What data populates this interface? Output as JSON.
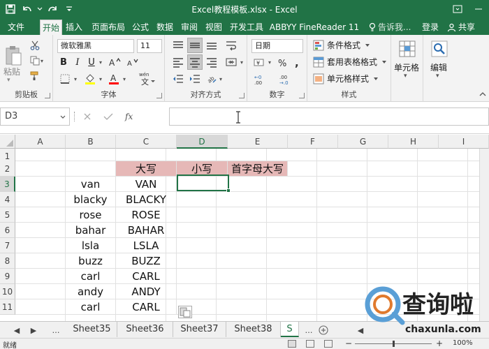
{
  "titlebar": {
    "title": "Excel教程模板.xlsx - Excel",
    "bg": "#217346"
  },
  "ribbon_tabs": [
    "文件",
    "开始",
    "插入",
    "页面布局",
    "公式",
    "数据",
    "审阅",
    "视图",
    "开发工具",
    "ABBYY FineReader 11"
  ],
  "active_tab": "开始",
  "tell_me": "告诉我...",
  "signin": "登录",
  "share": "共享",
  "clipboard": {
    "paste": "粘贴",
    "label": "剪贴板"
  },
  "font": {
    "name": "微软雅黑",
    "size": "11",
    "label": "字体"
  },
  "alignment": {
    "label": "对齐方式"
  },
  "number": {
    "format": "日期",
    "label": "数字"
  },
  "styles": {
    "conditional": "条件格式",
    "table": "套用表格格式",
    "cell_styles": "单元格样式",
    "label": "样式"
  },
  "cells": {
    "label": "单元格"
  },
  "editing": {
    "label": "编辑"
  },
  "formula_bar": {
    "name_box": "D3",
    "formula": ""
  },
  "columns": [
    "A",
    "B",
    "C",
    "D",
    "E",
    "F",
    "G",
    "H",
    "I"
  ],
  "rows": [
    "1",
    "2",
    "3",
    "4",
    "5",
    "6",
    "7",
    "8",
    "9",
    "10",
    "11"
  ],
  "table": {
    "header": [
      "大写",
      "小写",
      "首字母大写"
    ],
    "header_color": "#e6b8b7",
    "rows": [
      [
        "van",
        "VAN"
      ],
      [
        "blacky",
        "BLACKY"
      ],
      [
        "rose",
        "ROSE"
      ],
      [
        "bahar",
        "BAHAR"
      ],
      [
        "lsla",
        "LSLA"
      ],
      [
        "buzz",
        "BUZZ"
      ],
      [
        "carl",
        "CARL"
      ],
      [
        "andy",
        "ANDY"
      ],
      [
        "carl",
        "CARL"
      ]
    ]
  },
  "sheet_tabs": [
    "Sheet35",
    "Sheet36",
    "Sheet37",
    "Sheet38",
    "S"
  ],
  "active_sheet": "S",
  "status": {
    "mode": "就绪",
    "zoom": "100%"
  },
  "watermark": {
    "logo_text": "查询啦",
    "url": "chaxunla.com"
  }
}
